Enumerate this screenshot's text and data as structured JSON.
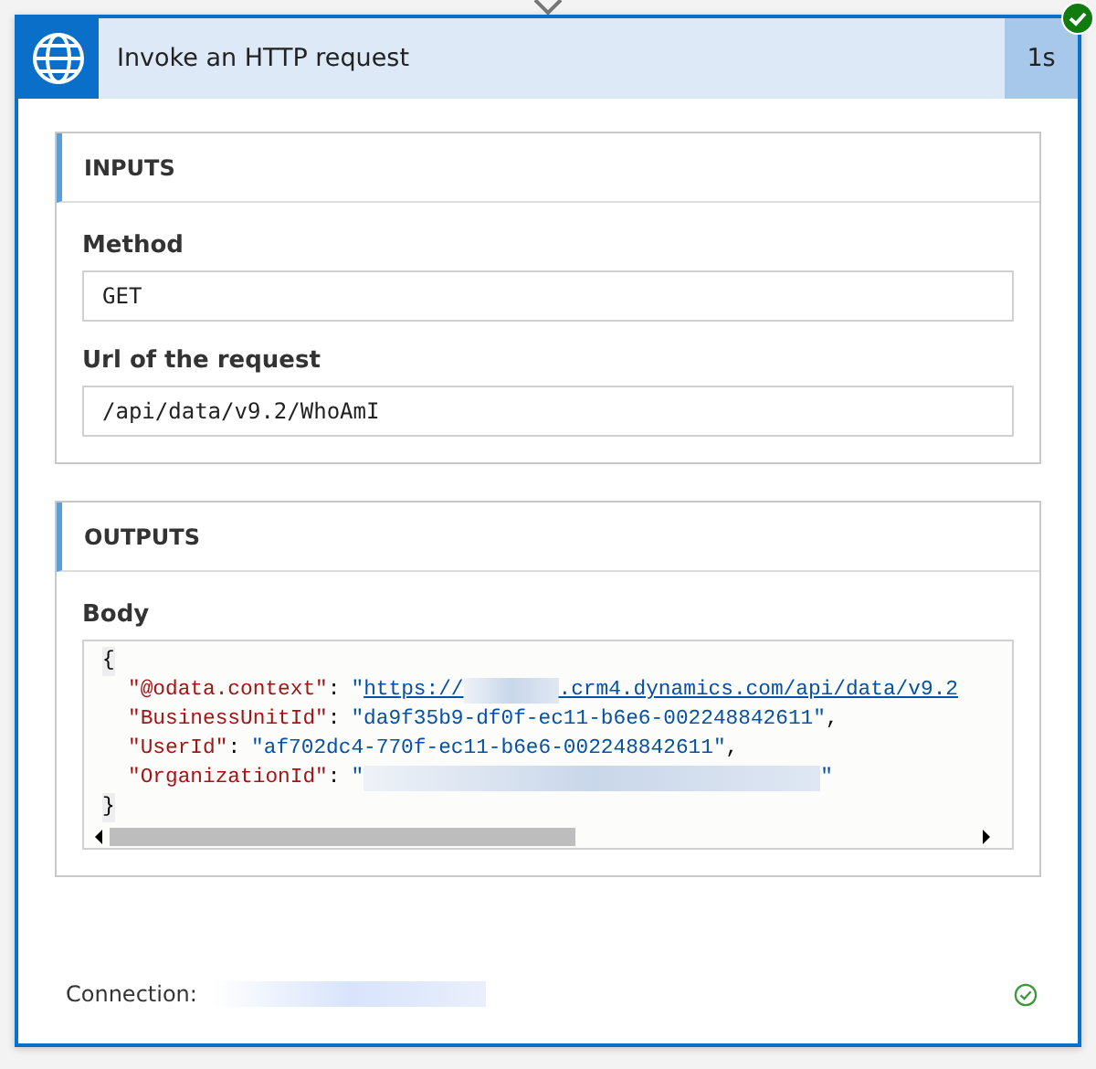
{
  "action": {
    "title": "Invoke an HTTP request",
    "duration": "1s",
    "succeeded": true
  },
  "inputs": {
    "heading": "INPUTS",
    "fields": [
      {
        "label": "Method",
        "value": "GET"
      },
      {
        "label": "Url of the request",
        "value": "/api/data/v9.2/WhoAmI"
      }
    ]
  },
  "outputs": {
    "heading": "OUTPUTS",
    "body_label": "Body",
    "lines": [
      {
        "kind": "brace",
        "text": "{"
      },
      {
        "kind": "pair",
        "key": "\"@odata.context\"",
        "sep": ":",
        "parts": [
          {
            "kind": "string",
            "text": "\""
          },
          {
            "kind": "link",
            "text": "https://"
          },
          {
            "kind": "redacted"
          },
          {
            "kind": "link",
            "text": ".crm4.dynamics.com/api/data/v9.2"
          }
        ]
      },
      {
        "kind": "pair",
        "key": "\"BusinessUnitId\"",
        "sep": ":",
        "parts": [
          {
            "kind": "string",
            "text": "\"da9f35b9-df0f-ec11-b6e6-002248842611\""
          },
          {
            "kind": "punct",
            "text": ","
          }
        ]
      },
      {
        "kind": "pair",
        "key": "\"UserId\"",
        "sep": ":",
        "parts": [
          {
            "kind": "string",
            "text": "\"af702dc4-770f-ec11-b6e6-002248842611\""
          },
          {
            "kind": "punct",
            "text": ","
          }
        ]
      },
      {
        "kind": "pair",
        "key": "\"OrganizationId\"",
        "sep": ":",
        "parts": [
          {
            "kind": "string",
            "text": "\""
          },
          {
            "kind": "redacted"
          },
          {
            "kind": "string",
            "text": "\""
          }
        ]
      },
      {
        "kind": "brace",
        "text": "}"
      }
    ]
  },
  "connection": {
    "label": "Connection:",
    "ok": true
  }
}
